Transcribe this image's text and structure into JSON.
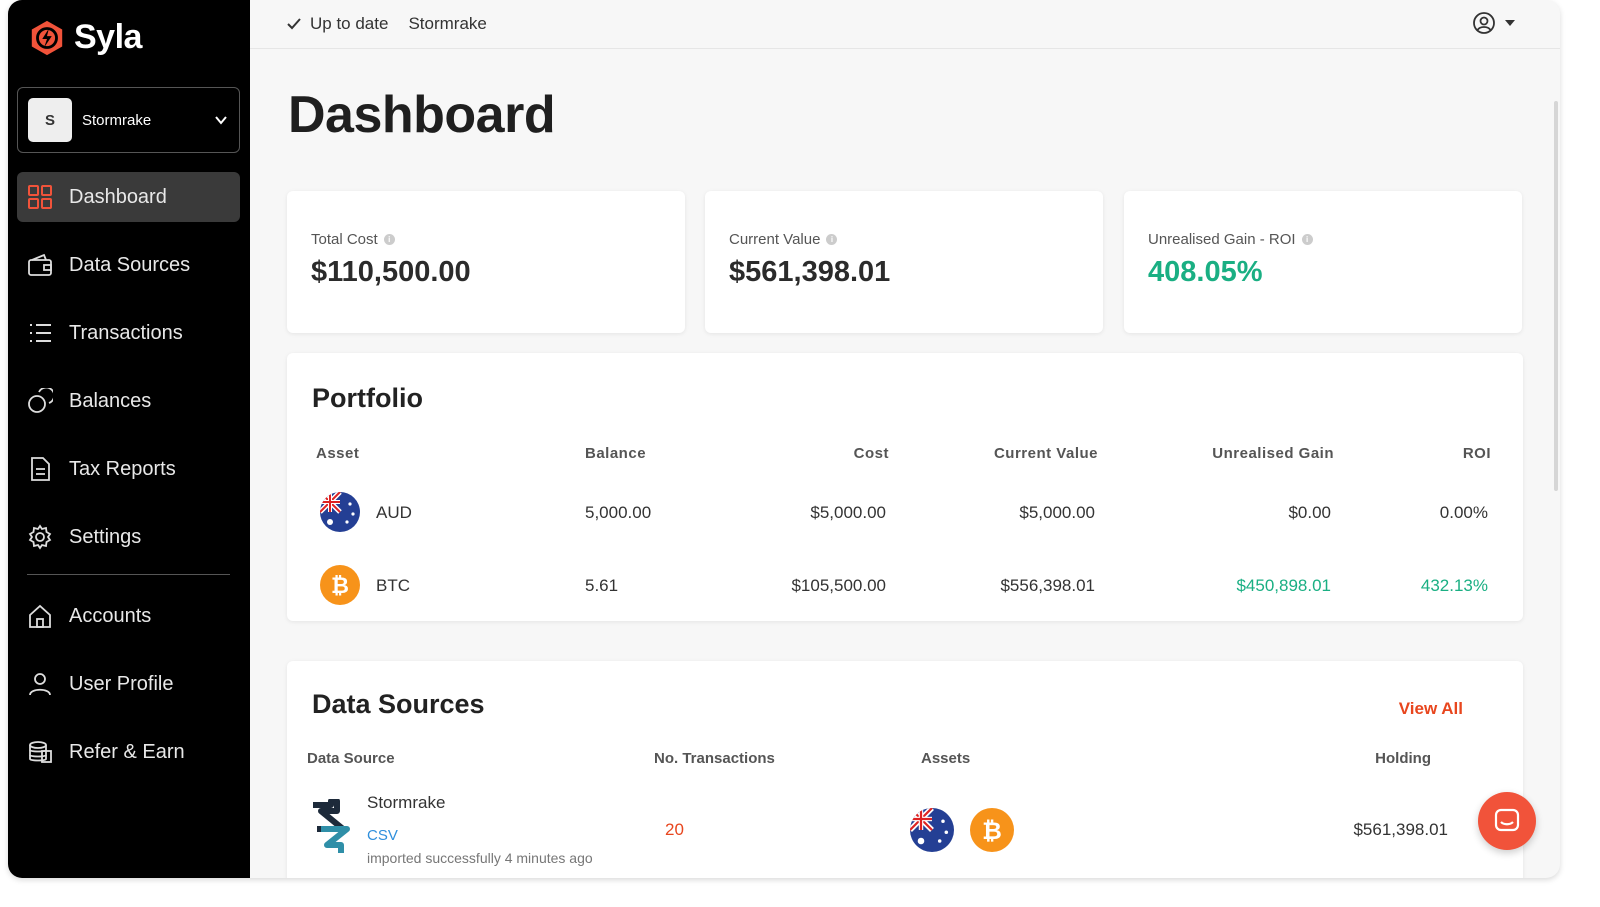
{
  "app": {
    "name": "Syla"
  },
  "account_selector": {
    "avatar_letter": "S",
    "name": "Stormrake"
  },
  "sidebar": {
    "items": [
      {
        "label": "Dashboard",
        "icon": "grid-icon"
      },
      {
        "label": "Data Sources",
        "icon": "wallet-icon"
      },
      {
        "label": "Transactions",
        "icon": "list-icon"
      },
      {
        "label": "Balances",
        "icon": "coins-icon"
      },
      {
        "label": "Tax Reports",
        "icon": "document-icon"
      },
      {
        "label": "Settings",
        "icon": "gear-icon"
      },
      {
        "label": "Accounts",
        "icon": "home-icon"
      },
      {
        "label": "User Profile",
        "icon": "user-icon"
      },
      {
        "label": "Refer & Earn",
        "icon": "stack-icon"
      }
    ]
  },
  "topbar": {
    "status": "Up to date",
    "sync_name": "Stormrake"
  },
  "page_title": "Dashboard",
  "stats": {
    "total_cost_label": "Total Cost",
    "total_cost_value": "$110,500.00",
    "current_value_label": "Current Value",
    "current_value_value": "$561,398.01",
    "roi_label": "Unrealised Gain - ROI",
    "roi_value": "408.05%"
  },
  "portfolio": {
    "title": "Portfolio",
    "headers": {
      "asset": "Asset",
      "balance": "Balance",
      "cost": "Cost",
      "current_value": "Current Value",
      "unrealised_gain": "Unrealised Gain",
      "roi": "ROI"
    },
    "rows": [
      {
        "asset": "AUD",
        "icon": "australia-flag-icon",
        "balance": "5,000.00",
        "cost": "$5,000.00",
        "current_value": "$5,000.00",
        "unrealised_gain": "$0.00",
        "roi": "0.00%"
      },
      {
        "asset": "BTC",
        "icon": "bitcoin-icon",
        "balance": "5.61",
        "cost": "$105,500.00",
        "current_value": "$556,398.01",
        "unrealised_gain": "$450,898.01",
        "roi": "432.13%"
      }
    ]
  },
  "data_sources": {
    "title": "Data Sources",
    "view_all": "View All",
    "headers": {
      "source": "Data Source",
      "transactions": "No. Transactions",
      "assets": "Assets",
      "holding": "Holding"
    },
    "rows": [
      {
        "name": "Stormrake",
        "type": "CSV",
        "status": "imported successfully 4 minutes ago",
        "transactions": "20",
        "holding": "$561,398.01"
      }
    ]
  },
  "colors": {
    "accent": "#e8461e",
    "positive": "#1aaf83",
    "link": "#2f8fdc",
    "sidebar_bg": "#000000"
  }
}
